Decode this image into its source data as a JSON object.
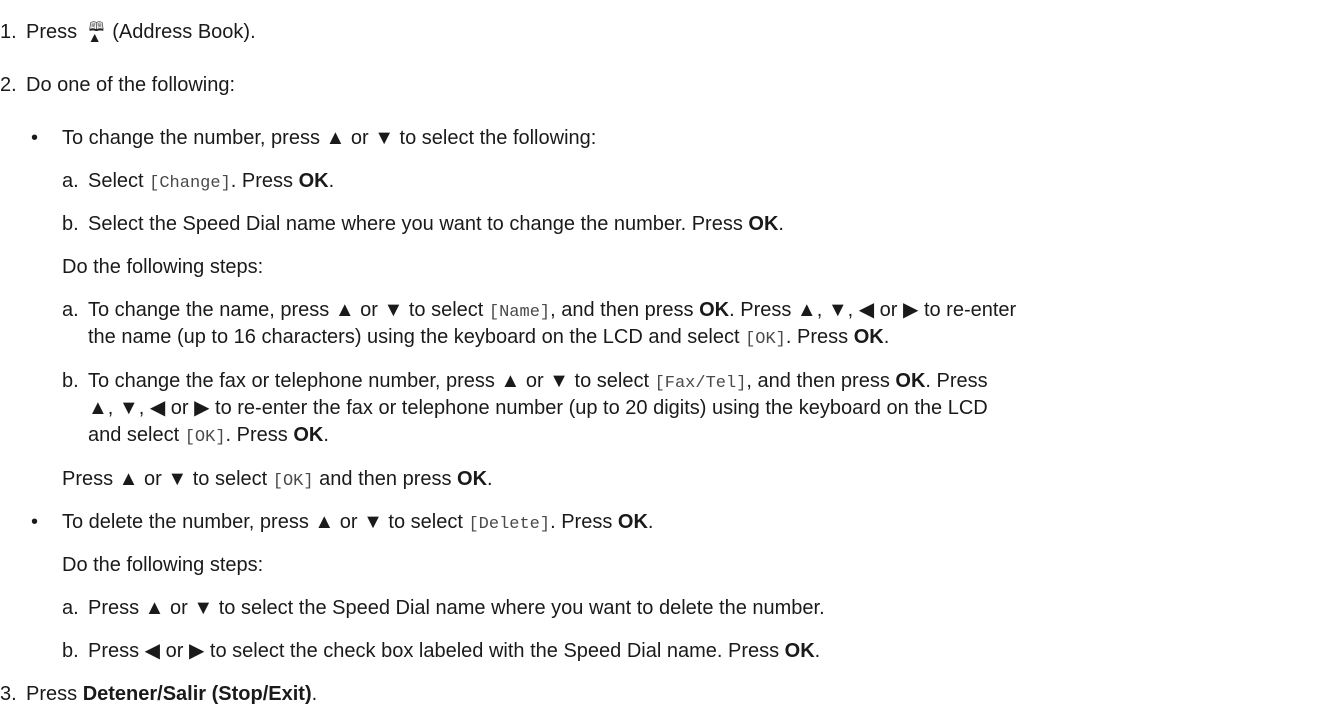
{
  "step1": {
    "num": "1.",
    "t1": "Press",
    "t2": "(Address Book)."
  },
  "step2": {
    "num": "2.",
    "text": "Do one of the following:"
  },
  "b1": {
    "bullet": "•",
    "text": "To change the number, press ▲ or ▼ to select the following:"
  },
  "b1a": {
    "lbl": "a.",
    "t1": "Select",
    "code": "[Change]",
    "t2": ". Press",
    "ok": "OK",
    "t3": "."
  },
  "b1b": {
    "lbl": "b.",
    "t1": "Select the Speed Dial name where you want to change the number. Press",
    "ok": "OK",
    "t2": "."
  },
  "b1steps": "Do the following steps:",
  "s1a": {
    "lbl": "a.",
    "t1": "To change the name, press ▲ or ▼ to select",
    "code1": "[Name]",
    "t2": ", and then press",
    "ok1": "OK",
    "t3": ". Press ▲, ▼, ◀ or ▶ to re-enter",
    "l2": "the name (up to 16 characters) using the keyboard on the LCD and select",
    "code2": "[OK]",
    "t4": ". Press",
    "ok2": "OK",
    "t5": "."
  },
  "s1b": {
    "lbl": "b.",
    "t1": "To change the fax or telephone number, press ▲ or ▼ to select",
    "code1": "[Fax/Tel]",
    "t2": ", and then press",
    "ok1": "OK",
    "t3": ". Press",
    "l2": "▲, ▼, ◀ or ▶ to re-enter the fax or telephone number (up to 20 digits) using the keyboard on the LCD",
    "l3": "and select",
    "code2": "[OK]",
    "t4": ". Press",
    "ok2": "OK",
    "t5": "."
  },
  "b1final": {
    "t1": "Press ▲ or ▼ to select",
    "code": "[OK]",
    "t2": "and then press",
    "ok": "OK",
    "t3": "."
  },
  "b2": {
    "bullet": "•",
    "t1": "To delete the number, press ▲ or ▼ to select",
    "code": "[Delete]",
    "t2": ". Press",
    "ok": "OK",
    "t3": "."
  },
  "b2steps": "Do the following steps:",
  "s2a": {
    "lbl": "a.",
    "text": "Press ▲ or ▼ to select the Speed Dial name where you want to delete the number."
  },
  "s2b": {
    "lbl": "b.",
    "t1": "Press ◀ or ▶ to select the check box labeled with the Speed Dial name. Press",
    "ok": "OK",
    "t2": "."
  },
  "step3": {
    "num": "3.",
    "t1": "Press",
    "bold": "Detener/Salir (Stop/Exit)",
    "t2": "."
  },
  "icons": {
    "address_book": "address-book-icon"
  }
}
